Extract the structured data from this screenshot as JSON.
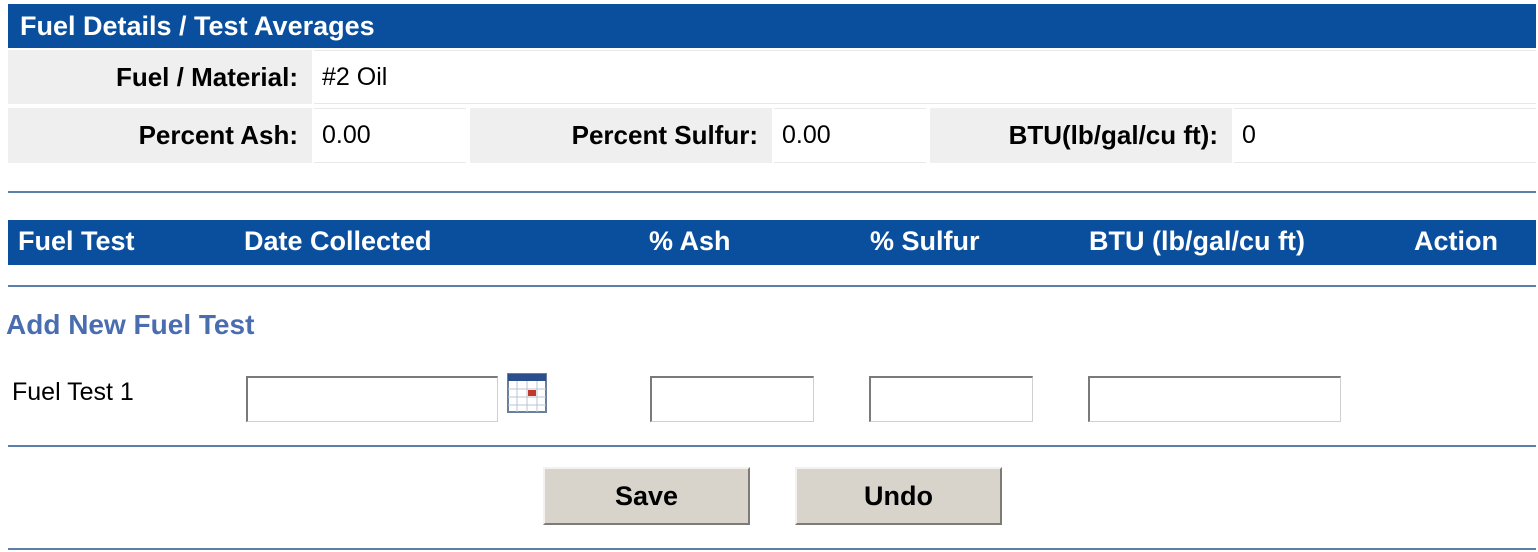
{
  "details": {
    "title": "Fuel Details / Test Averages",
    "fuel_label": "Fuel / Material:",
    "fuel_value": "#2 Oil",
    "ash_label": "Percent Ash:",
    "ash_value": "0.00",
    "sulfur_label": "Percent Sulfur:",
    "sulfur_value": "0.00",
    "btu_label": "BTU(lb/gal/cu ft):",
    "btu_value": "0"
  },
  "tests_table": {
    "headers": [
      "Fuel Test",
      "Date Collected",
      "% Ash",
      "% Sulfur",
      "BTU (lb/gal/cu ft)",
      "Action"
    ]
  },
  "add_form": {
    "title": "Add New Fuel Test",
    "row_label": "Fuel Test 1",
    "date_value": "",
    "ash_value": "",
    "sulfur_value": "",
    "btu_value": "",
    "calendar_icon": "calendar-icon"
  },
  "buttons": {
    "save_label": "Save",
    "undo_label": "Undo"
  },
  "colors": {
    "header_bg": "#0a4f9d",
    "label_bg": "#efefef",
    "section_title": "#4a6db0",
    "button_bg": "#d8d4cc"
  }
}
